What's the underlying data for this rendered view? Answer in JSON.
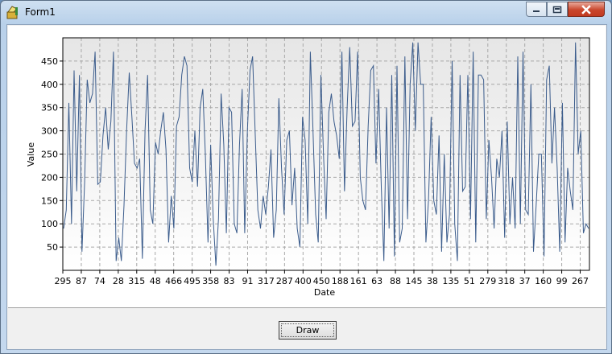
{
  "window": {
    "title": "Form1"
  },
  "toolbar": {
    "draw_label": "Draw"
  },
  "chart_data": {
    "type": "line",
    "xlabel": "Date",
    "ylabel": "Value",
    "ylim": [
      0,
      500
    ],
    "yticks": [
      50,
      100,
      150,
      200,
      250,
      300,
      350,
      400,
      450
    ],
    "xtick_labels": [
      "295",
      "87",
      "74",
      "28",
      "315",
      "48",
      "466",
      "495",
      "358",
      "83",
      "91",
      "317",
      "287",
      "400",
      "450",
      "188",
      "161",
      "63",
      "88",
      "145",
      "38",
      "135",
      "51",
      "279",
      "318",
      "37",
      "160",
      "99",
      "267"
    ],
    "grid": true,
    "series_color": "#3b5c8c",
    "values": [
      90,
      130,
      360,
      100,
      430,
      170,
      420,
      40,
      190,
      410,
      360,
      380,
      470,
      185,
      190,
      290,
      350,
      260,
      320,
      470,
      20,
      70,
      20,
      140,
      300,
      425,
      330,
      230,
      220,
      240,
      25,
      300,
      420,
      130,
      100,
      275,
      250,
      300,
      340,
      260,
      60,
      160,
      90,
      310,
      330,
      420,
      460,
      440,
      220,
      190,
      300,
      180,
      350,
      390,
      250,
      60,
      270,
      110,
      10,
      110,
      380,
      270,
      80,
      350,
      340,
      100,
      80,
      270,
      390,
      80,
      300,
      430,
      460,
      290,
      130,
      90,
      160,
      120,
      180,
      260,
      70,
      130,
      370,
      220,
      120,
      280,
      300,
      140,
      220,
      90,
      50,
      330,
      280,
      100,
      470,
      300,
      120,
      60,
      420,
      250,
      110,
      340,
      380,
      320,
      290,
      240,
      470,
      170,
      350,
      480,
      310,
      320,
      470,
      200,
      150,
      130,
      310,
      430,
      440,
      230,
      390,
      180,
      20,
      350,
      90,
      420,
      30,
      440,
      60,
      90,
      460,
      110,
      400,
      490,
      300,
      490,
      400,
      400,
      60,
      150,
      330,
      150,
      120,
      290,
      40,
      250,
      60,
      120,
      450,
      100,
      20,
      420,
      170,
      180,
      420,
      110,
      470,
      60,
      420,
      420,
      410,
      110,
      280,
      200,
      90,
      240,
      200,
      300,
      70,
      320,
      100,
      200,
      90,
      460,
      100,
      470,
      130,
      120,
      400,
      40,
      140,
      250,
      250,
      30,
      410,
      440,
      230,
      350,
      220,
      40,
      360,
      60,
      220,
      170,
      130,
      490,
      250,
      300,
      80,
      100,
      90
    ]
  }
}
